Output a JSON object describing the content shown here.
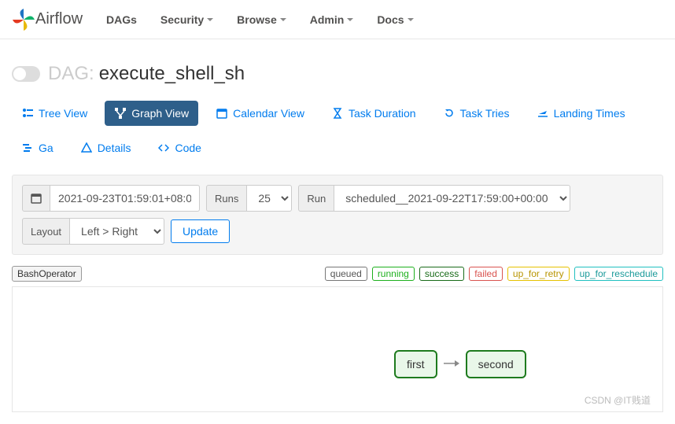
{
  "brand": "Airflow",
  "nav": {
    "dags": "DAGs",
    "security": "Security",
    "browse": "Browse",
    "admin": "Admin",
    "docs": "Docs"
  },
  "dag": {
    "label": "DAG:",
    "name": "execute_shell_sh"
  },
  "tabs": {
    "tree": "Tree View",
    "graph": "Graph View",
    "calendar": "Calendar View",
    "duration": "Task Duration",
    "tries": "Task Tries",
    "landing": "Landing Times",
    "gantt": "Ga",
    "details": "Details",
    "code": "Code"
  },
  "controls": {
    "date_value": "2021-09-23T01:59:01+08:0",
    "runs_label": "Runs",
    "runs_value": "25",
    "run_label": "Run",
    "run_value": "scheduled__2021-09-22T17:59:00+00:00",
    "layout_label": "Layout",
    "layout_value": "Left > Right",
    "update": "Update"
  },
  "operator": "BashOperator",
  "legend": {
    "queued": "queued",
    "running": "running",
    "success": "success",
    "failed": "failed",
    "retry": "up_for_retry",
    "resched": "up_for_reschedule"
  },
  "graph": {
    "node1": "first",
    "node2": "second"
  },
  "watermark": "CSDN @IT贱道"
}
